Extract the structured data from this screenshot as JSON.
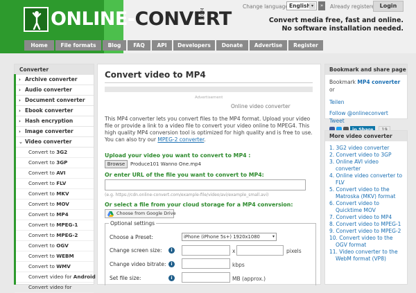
{
  "header": {
    "logo": {
      "part1": "ONLINE-",
      "part2": "CONVERT",
      "dotcom": ".COM"
    },
    "change_language_label": "Change language:",
    "language_value": "English",
    "language_go": "»",
    "already_registered_label": "Already registered?",
    "login_label": "Login",
    "tagline_line1": "Convert media free, fast and online.",
    "tagline_line2": "No software installation needed."
  },
  "nav": {
    "tabs": [
      {
        "label": "Home"
      },
      {
        "label": "File formats"
      },
      {
        "label": "Blog"
      },
      {
        "label": "FAQ"
      },
      {
        "label": "API"
      },
      {
        "label": "Developers"
      },
      {
        "label": "Donate"
      },
      {
        "label": "Advertise"
      },
      {
        "label": "Register"
      }
    ]
  },
  "sidebar_left": {
    "header": "Converter",
    "categories": [
      {
        "label": "Archive converter"
      },
      {
        "label": "Audio converter"
      },
      {
        "label": "Document converter"
      },
      {
        "label": "Ebook converter"
      },
      {
        "label": "Hash encryption"
      },
      {
        "label": "Image converter"
      },
      {
        "label": "Video converter"
      }
    ],
    "sub_items": [
      {
        "prefix": "Convert to ",
        "bold": "3G2"
      },
      {
        "prefix": "Convert to ",
        "bold": "3GP"
      },
      {
        "prefix": "Convert to ",
        "bold": "AVI"
      },
      {
        "prefix": "Convert to ",
        "bold": "FLV"
      },
      {
        "prefix": "Convert to ",
        "bold": "MKV"
      },
      {
        "prefix": "Convert to ",
        "bold": "MOV"
      },
      {
        "prefix": "Convert to ",
        "bold": "MP4"
      },
      {
        "prefix": "Convert to ",
        "bold": "MPEG-1"
      },
      {
        "prefix": "Convert to ",
        "bold": "MPEG-2"
      },
      {
        "prefix": "Convert to ",
        "bold": "OGV"
      },
      {
        "prefix": "Convert to ",
        "bold": "WEBM"
      },
      {
        "prefix": "Convert to ",
        "bold": "WMV"
      },
      {
        "prefix": "Convert video for ",
        "bold": "Android"
      },
      {
        "prefix": "Convert video for",
        "bold": ""
      }
    ]
  },
  "main": {
    "title": "Convert video to MP4",
    "ad_label": "Advertisement",
    "ad_title": "Online video converter",
    "description": "This MP4 converter lets you convert files to the MP4 format. Upload your video file or provide a link to a video file to convert your video online to MPEG4. This high quality MP4 conversion tool is optimized for high quality and is free to use. You can also try our ",
    "description_link": "MPEG-2 converter",
    "description_end": ".",
    "upload_label": "Upload your video you want to convert to MP4 :",
    "browse_label": "Browse",
    "file_name": "Produce101 Wanno One.mp4",
    "url_label": "Or enter URL of the file you want to convert to MP4:",
    "url_value": "",
    "url_hint": "(e.g. https://cdn.online-convert.com/example-file/video/avi/example_small.avi)",
    "cloud_label": "Or select a file from your cloud storage for a MP4 conversion:",
    "gdrive_label": "Choose from Google Drive",
    "optional_settings": "Optional settings",
    "preset_label": "Choose a Preset:",
    "preset_value": "iPhone (iPhone 5s+) 1920x1080",
    "screen_size_label": "Change screen size:",
    "screen_size_x": "x",
    "screen_size_unit": "pixels",
    "bitrate_label": "Change video bitrate:",
    "bitrate_unit": "kbps",
    "file_size_label": "Set file size:",
    "file_size_unit": "MB (approx.)",
    "info_glyph": "i"
  },
  "sidebar_right": {
    "bookmark_header": "Bookmark and share page",
    "bookmark_text_1": "Bookmark ",
    "bookmark_bold": "MP4 converter",
    "bookmark_text_2": " or",
    "teilen": "Teilen",
    "follow": "Follow @onlineconvert Tweet",
    "in_share": "in Share",
    "in_count": "19",
    "more_header": "More video converter",
    "more_items": [
      "1. 3G2 video converter",
      "2. Convert video to 3GP",
      "3. Online AVI video converter",
      "4. Online video converter to FLV",
      "5. Convert video to the Matroska (MKV) format",
      "6. Convert video to Quicktime MOV",
      "7. Convert video to MP4",
      "8. Convert video to MPEG-1",
      "9. Convert video to MPEG-2",
      "10. Convert video to the OGV format",
      "11. Video converter to the WebM format (VP8)"
    ]
  },
  "colors": {
    "brand_green": "#2d9a2d",
    "link_blue": "#1a6fb3",
    "nav_gray": "#8a8a8a"
  },
  "icons": [
    "person-logo-icon",
    "chevron-right-icon",
    "chevron-down-icon",
    "info-icon",
    "google-drive-icon",
    "facebook-icon",
    "twitter-icon",
    "linkedin-icon"
  ]
}
